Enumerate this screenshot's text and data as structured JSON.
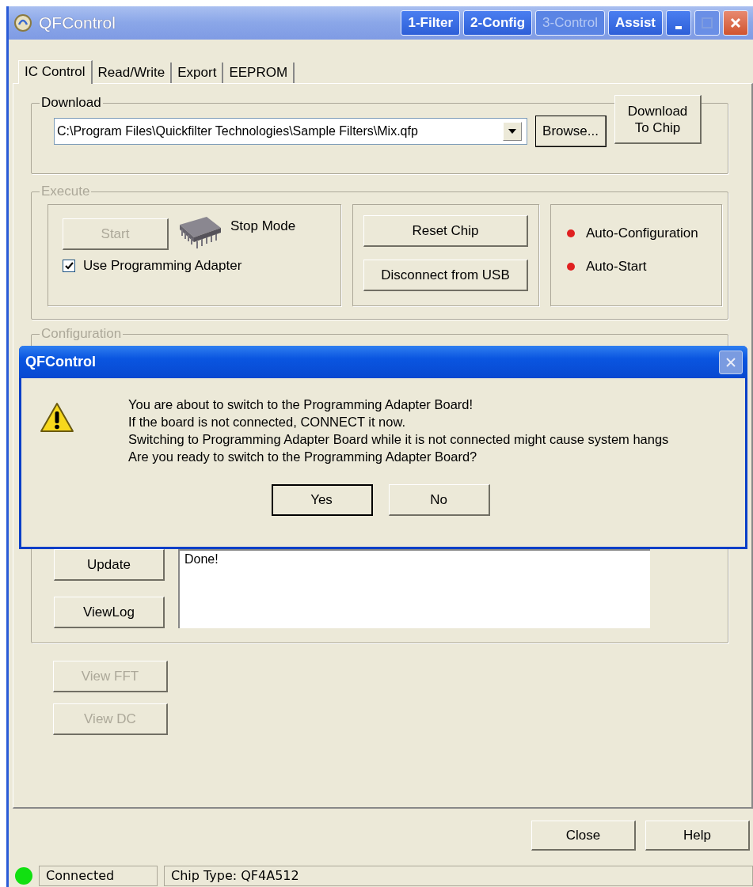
{
  "window": {
    "title": "QFControl",
    "nav_buttons": [
      {
        "label": "1-Filter",
        "disabled": false
      },
      {
        "label": "2-Config",
        "disabled": false
      },
      {
        "label": "3-Control",
        "disabled": true
      },
      {
        "label": "Assist",
        "disabled": false
      }
    ]
  },
  "tabs": [
    {
      "label": "IC Control",
      "selected": true
    },
    {
      "label": "Read/Write",
      "selected": false
    },
    {
      "label": "Export",
      "selected": false
    },
    {
      "label": "EEPROM",
      "selected": false
    }
  ],
  "download": {
    "legend": "Download",
    "disabled": false,
    "file_path": "C:\\Program Files\\Quickfilter Technologies\\Sample Filters\\Mix.qfp",
    "browse_button": "Browse...",
    "download_button": [
      "Download",
      "To Chip"
    ]
  },
  "execute": {
    "legend": "Execute",
    "disabled": true,
    "start_button": {
      "label": "Start",
      "disabled": true
    },
    "mode": "Stop Mode",
    "use_adapter": {
      "label": "Use Programming Adapter",
      "checked": true
    },
    "reset_button": "Reset Chip",
    "disconnect_button": "Disconnect from USB",
    "indicators": [
      {
        "label": "Auto-Configuration",
        "color": "#e02020"
      },
      {
        "label": "Auto-Start",
        "color": "#e02020"
      }
    ]
  },
  "configuration": {
    "legend": "Configuration",
    "disabled": true,
    "update_button": "Update",
    "view_log_button": "ViewLog",
    "log": "Done!"
  },
  "view_buttons": [
    {
      "label": "View FFT",
      "disabled": true
    },
    {
      "label": "View DC",
      "disabled": true
    }
  ],
  "footer_buttons": [
    "Close",
    "Help"
  ],
  "status_bar": {
    "connected": true,
    "status": "Connected",
    "chip_type": "Chip Type: QF4A512"
  },
  "dialog": {
    "title": "QFControl",
    "message_lines": [
      "You are about to switch to the Programming Adapter Board!",
      "If the board is not connected, CONNECT it now.",
      "Switching to Programming Adapter Board while it is not connected might cause system hangs",
      "Are you ready to switch to the Programming Adapter Board?"
    ],
    "buttons": [
      {
        "label": "Yes",
        "focused": true
      },
      {
        "label": "No",
        "focused": false
      }
    ]
  }
}
